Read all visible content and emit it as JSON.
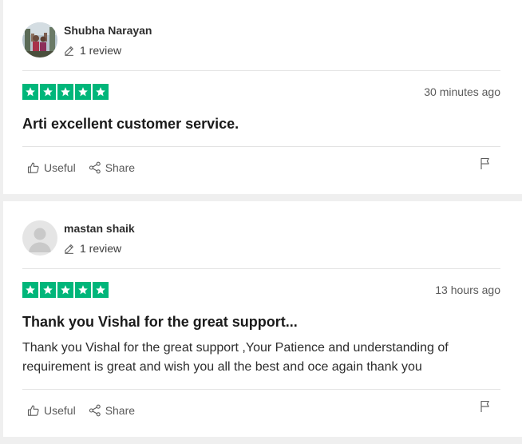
{
  "reviews": [
    {
      "reviewer_name": "Shubha Narayan",
      "review_count": "1 review",
      "rating": 5,
      "date": "30 minutes ago",
      "title": "Arti excellent customer service.",
      "text": "",
      "useful_label": "Useful",
      "share_label": "Share"
    },
    {
      "reviewer_name": "mastan shaik",
      "review_count": "1 review",
      "rating": 5,
      "date": "13 hours ago",
      "title": "Thank you Vishal for the great support...",
      "text": "Thank you Vishal for the great support ,Your Patience and understanding of requirement is great and wish you all the best and oce again thank you",
      "useful_label": "Useful",
      "share_label": "Share"
    }
  ],
  "colors": {
    "star_green": "#00b67a",
    "card_background": "#ffffff",
    "page_background": "#efefef",
    "divider": "#e3e3e3"
  },
  "icons": {
    "avatar_1": "photo-avatar",
    "avatar_2": "default-person-avatar",
    "review_count": "pencil-icon",
    "useful": "thumbs-up-icon",
    "share": "share-icon",
    "report": "flag-icon"
  }
}
